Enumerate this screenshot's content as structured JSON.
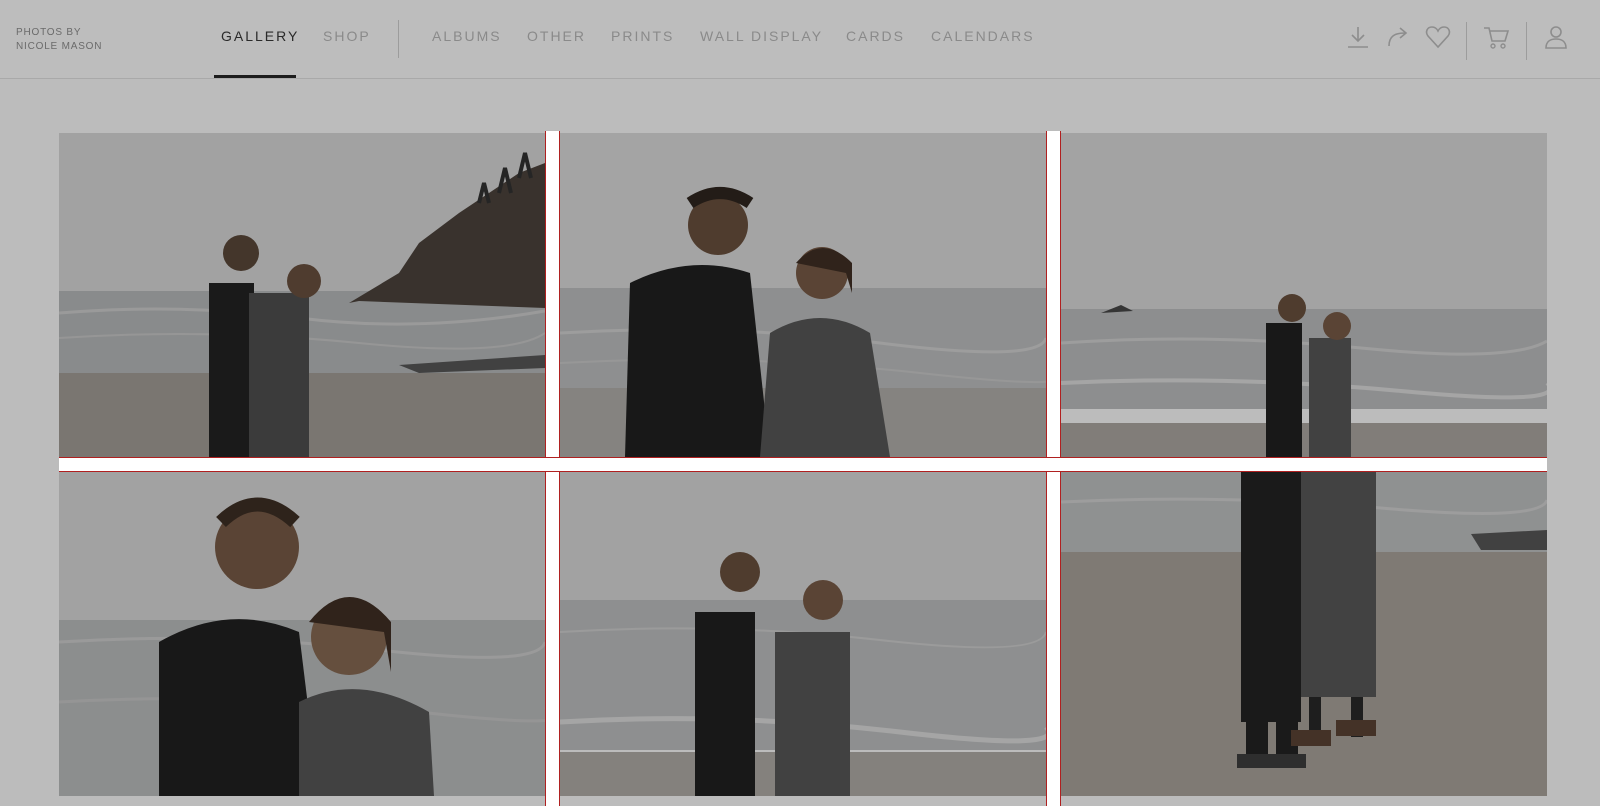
{
  "brand": {
    "line1": "PHOTOS BY",
    "line2": "NICOLE MASON"
  },
  "nav": {
    "primary": [
      {
        "label": "GALLERY",
        "active": true
      },
      {
        "label": "SHOP",
        "active": false
      }
    ],
    "secondary": [
      {
        "label": "ALBUMS"
      },
      {
        "label": "OTHER"
      },
      {
        "label": "PRINTS"
      },
      {
        "label": "WALL DISPLAY"
      },
      {
        "label": "CARDS"
      },
      {
        "label": "CALENDARS"
      }
    ]
  },
  "actions": [
    {
      "icon": "download-icon"
    },
    {
      "icon": "share-icon"
    },
    {
      "icon": "heart-icon"
    },
    {
      "icon": "cart-icon"
    },
    {
      "icon": "user-icon"
    }
  ],
  "colors": {
    "overlay_bg": "#bcbcbc",
    "active_text": "#2a2a2a",
    "inactive_text": "#8a8a8a",
    "selection_accent": "#b02020"
  }
}
